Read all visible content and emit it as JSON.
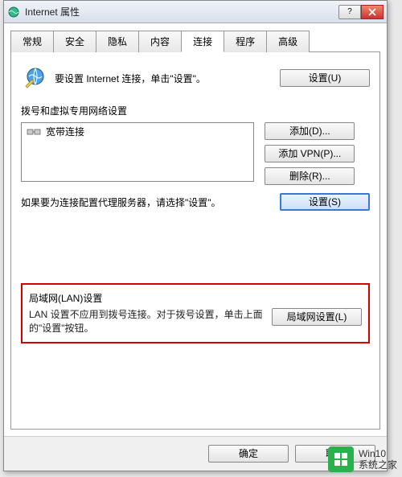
{
  "window": {
    "title": "Internet 属性"
  },
  "tabs": [
    "常规",
    "安全",
    "隐私",
    "内容",
    "连接",
    "程序",
    "高级"
  ],
  "active_tab_index": 4,
  "setup": {
    "message": "要设置 Internet 连接，单击\"设置\"。",
    "button": "设置(U)"
  },
  "dialup": {
    "legend": "拨号和虚拟专用网络设置",
    "items": [
      {
        "label": "宽带连接"
      }
    ],
    "buttons": {
      "add": "添加(D)...",
      "add_vpn": "添加 VPN(P)...",
      "remove": "删除(R)..."
    },
    "proxy_message": "如果要为连接配置代理服务器，请选择\"设置\"。",
    "proxy_button": "设置(S)"
  },
  "lan": {
    "legend": "局域网(LAN)设置",
    "message": "LAN 设置不应用到拨号连接。对于拨号设置，单击上面的\"设置\"按钮。",
    "button": "局域网设置(L)"
  },
  "footer": {
    "ok": "确定",
    "cancel": "取消"
  },
  "brand": {
    "line1": "Win10",
    "line2": "系统之家"
  }
}
